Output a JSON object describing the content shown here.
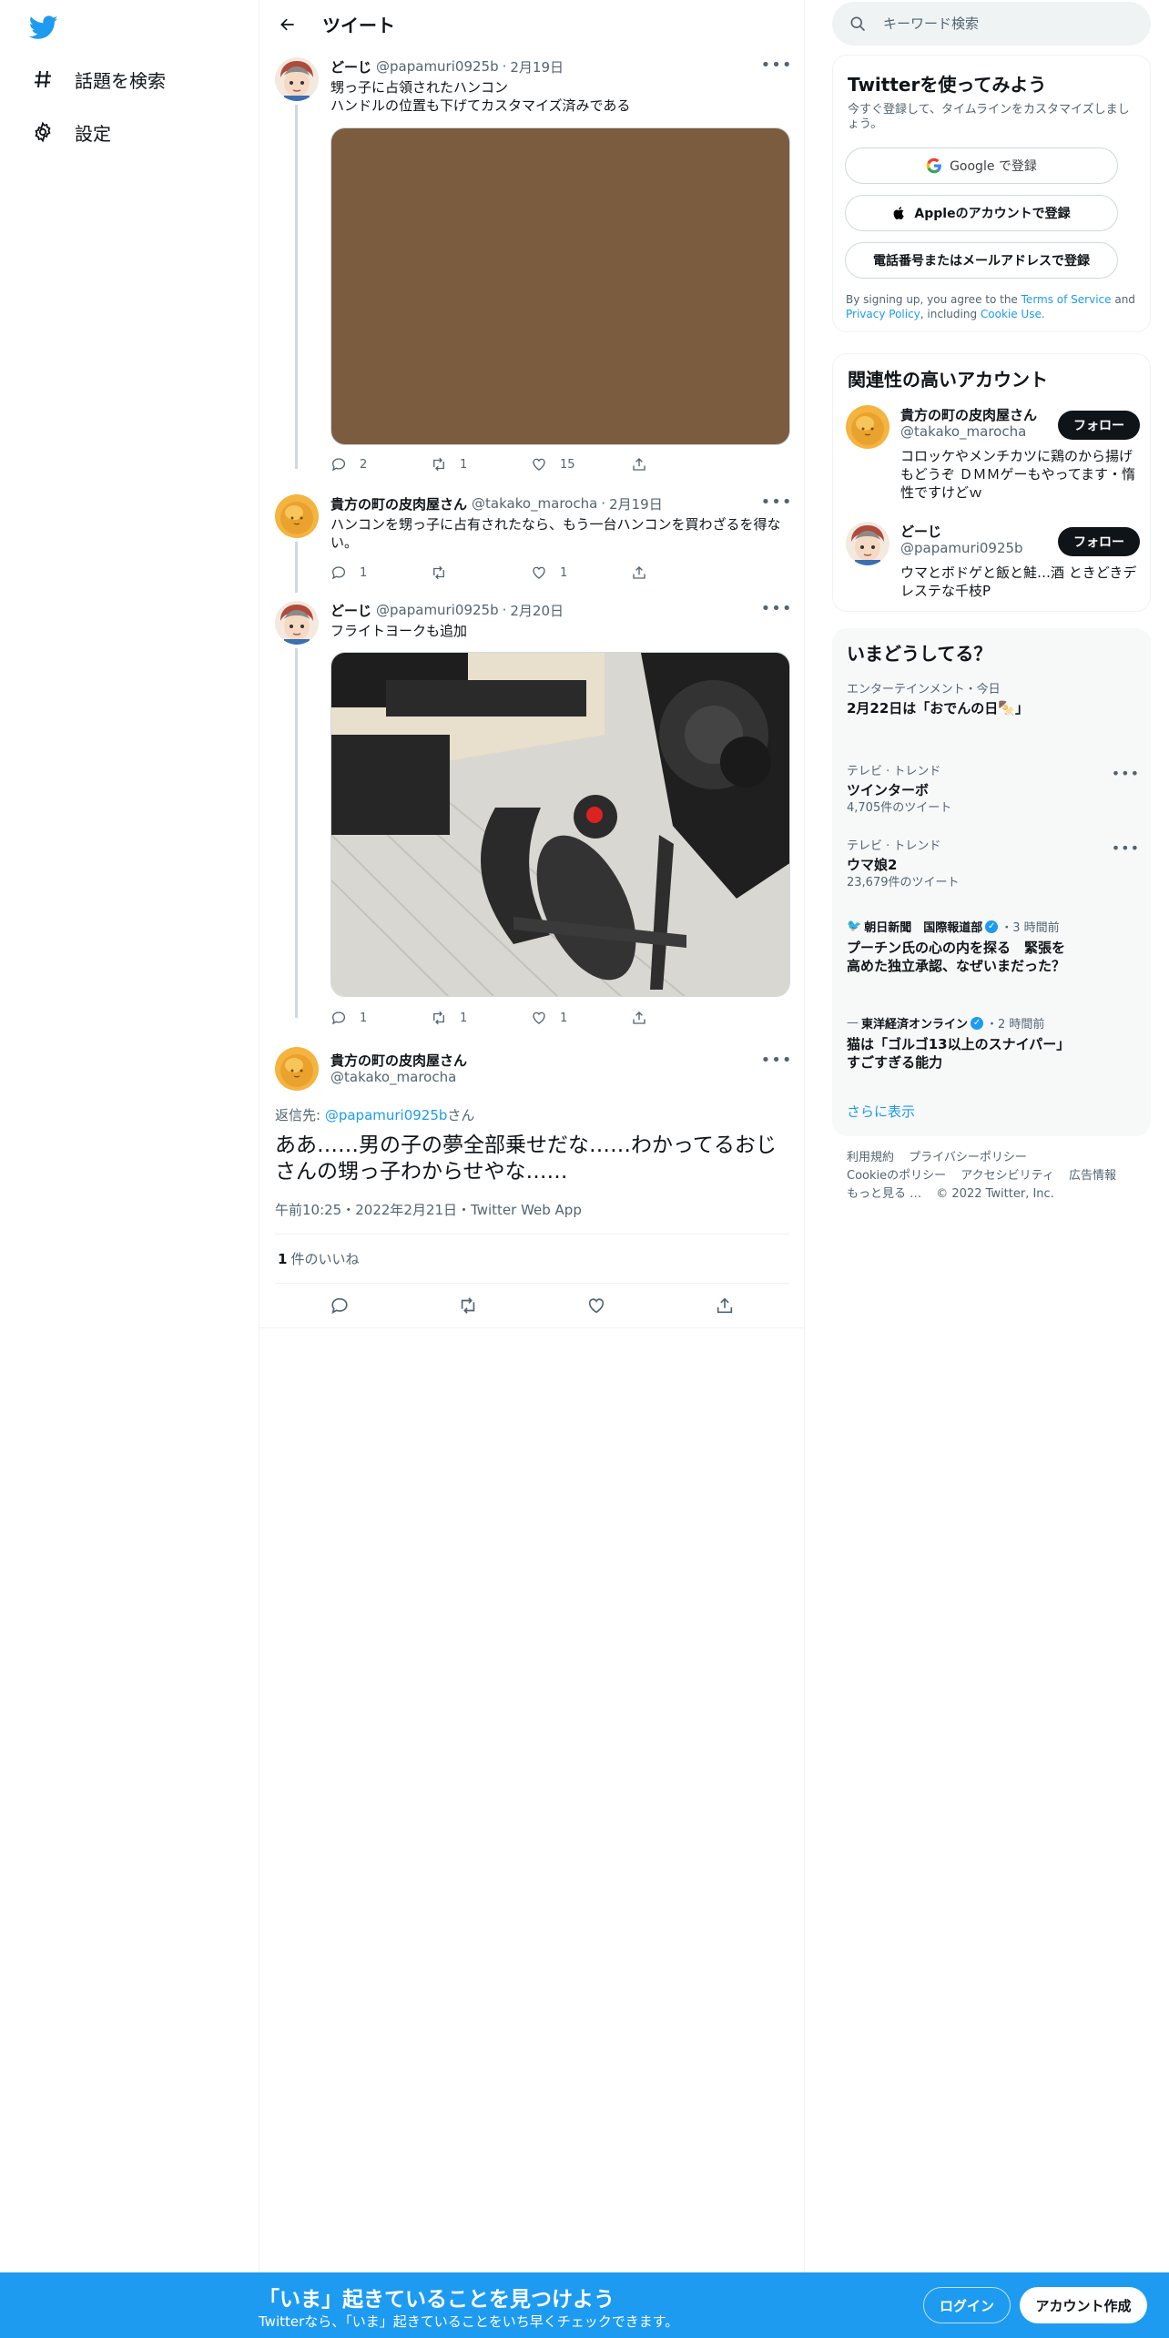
{
  "nav": {
    "explore_label": "話題を検索",
    "settings_label": "設定"
  },
  "header": {
    "title": "ツイート"
  },
  "thread": [
    {
      "name": "どーじ",
      "handle": "@papamuri0925b",
      "date": "2月19日",
      "text_lines": [
        "甥っ子に占領されたハンコン",
        "ハンドルの位置も下げてカスタマイズ済みである"
      ],
      "replies": "2",
      "retweets": "1",
      "likes": "15"
    },
    {
      "name": "貴方の町の皮肉屋さん",
      "handle": "@takako_marocha",
      "date": "2月19日",
      "text": "ハンコンを甥っ子に占有されたなら、もう一台ハンコンを買わざるを得ない。",
      "replies": "1",
      "retweets": "",
      "likes": "1"
    },
    {
      "name": "どーじ",
      "handle": "@papamuri0925b",
      "date": "2月20日",
      "text": "フライトヨークも追加",
      "replies": "1",
      "retweets": "1",
      "likes": "1"
    }
  ],
  "main_tweet": {
    "name": "貴方の町の皮肉屋さん",
    "handle": "@takako_marocha",
    "reply_prefix": "返信先: ",
    "reply_handle": "@papamuri0925b",
    "reply_suffix": "さん",
    "text": "ああ……男の子の夢全部乗せだな……わかってるおじさんの甥っ子わからせやな……",
    "meta": "午前10:25・2022年2月21日・Twitter Web App",
    "likes_count": "1",
    "likes_label": "件のいいね"
  },
  "search": {
    "placeholder": "キーワード検索"
  },
  "signup": {
    "title": "Twitterを使ってみよう",
    "subtitle": "今すぐ登録して、タイムラインをカスタマイズしましょう。",
    "google": "Google で登録",
    "apple": "Appleのアカウントで登録",
    "phone": "電話番号またはメールアドレスで登録",
    "terms_1": "By signing up, you agree to the ",
    "terms_link1": "Terms of Service",
    "terms_2": " and ",
    "terms_link2": "Privacy Policy",
    "terms_3": ", including ",
    "terms_link3": "Cookie Use.",
    "terms_4": ""
  },
  "related": {
    "title": "関連性の高いアカウント",
    "accounts": [
      {
        "name": "貴方の町の皮肉屋さん",
        "handle": "@takako_marocha",
        "bio": "コロッケやメンチカツに鶏のから揚げもどうぞ ＤＭＭゲーもやってます・惰性ですけどｗ",
        "follow": "フォロー"
      },
      {
        "name": "どーじ",
        "handle": "@papamuri0925b",
        "bio": "ウマとボドゲと飯と鮭…酒 ときどきデレステな千枝P",
        "follow": "フォロー"
      }
    ]
  },
  "trends": {
    "title": "いまどうしてる？",
    "items": [
      {
        "meta": "エンターテインメント・今日",
        "title": "2月22日は「おでんの日🍢」",
        "count": ""
      },
      {
        "meta": "テレビ · トレンド",
        "title": "ツインターボ",
        "count": "4,705件のツイート"
      },
      {
        "meta": "テレビ · トレンド",
        "title": "ウマ娘2",
        "count": "23,679件のツイート"
      }
    ],
    "news": [
      {
        "source": "朝日新聞　国際報道部",
        "time": "・3 時間前",
        "title": "プーチン氏の心の内を探る　緊張を高めた独立承認、なぜいまだった？"
      },
      {
        "source": "東洋経済オンライン",
        "time": "・2 時間前",
        "title": "猫は「ゴルゴ13以上のスナイパー」すごすぎる能力"
      }
    ],
    "show_more": "さらに表示"
  },
  "footer": {
    "links": [
      "利用規約",
      "プライバシーポリシー",
      "Cookieのポリシー",
      "アクセシビリティ",
      "広告情報",
      "もっと見る …"
    ],
    "copyright": "© 2022 Twitter, Inc."
  },
  "bottombar": {
    "title": "「いま」起きていることを見つけよう",
    "subtitle": "Twitterなら、「いま」起きていることをいち早くチェックできます。",
    "login": "ログイン",
    "signup": "アカウント作成"
  },
  "colors": {
    "accent": "#1d9bf0",
    "text": "#0f1419",
    "muted": "#536471",
    "border": "#eff3f4",
    "media_placeholder": "#7b5c3e"
  }
}
